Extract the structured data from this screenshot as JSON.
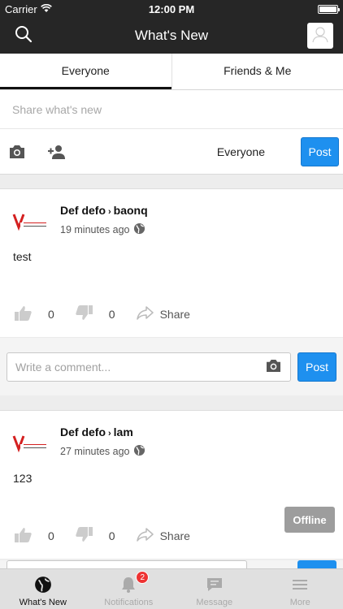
{
  "status_bar": {
    "carrier": "Carrier",
    "time": "12:00 PM"
  },
  "nav": {
    "title": "What's New"
  },
  "tabs": [
    {
      "label": "Everyone",
      "active": true
    },
    {
      "label": "Friends & Me",
      "active": false
    }
  ],
  "composer": {
    "placeholder": "Share what's new",
    "privacy": "Everyone",
    "post_label": "Post"
  },
  "posts": [
    {
      "author": "Def defo",
      "target": "baonq",
      "time": "19 minutes ago",
      "body": "test",
      "likes": "0",
      "dislikes": "0",
      "share_label": "Share",
      "comment_placeholder": "Write a comment...",
      "post_label": "Post"
    },
    {
      "author": "Def defo",
      "target": "lam",
      "time": "27 minutes ago",
      "body": "123",
      "likes": "0",
      "dislikes": "0",
      "share_label": "Share",
      "offline_label": "Offline"
    }
  ],
  "tab_bar": [
    {
      "label": "What's New",
      "active": true,
      "icon": "globe-icon"
    },
    {
      "label": "Notifications",
      "badge": "2",
      "icon": "bell-icon"
    },
    {
      "label": "Message",
      "icon": "chat-icon"
    },
    {
      "label": "More",
      "icon": "menu-icon"
    }
  ],
  "colors": {
    "accent": "#1e90ef",
    "nav_bg": "#262626",
    "badge": "#e33333"
  }
}
